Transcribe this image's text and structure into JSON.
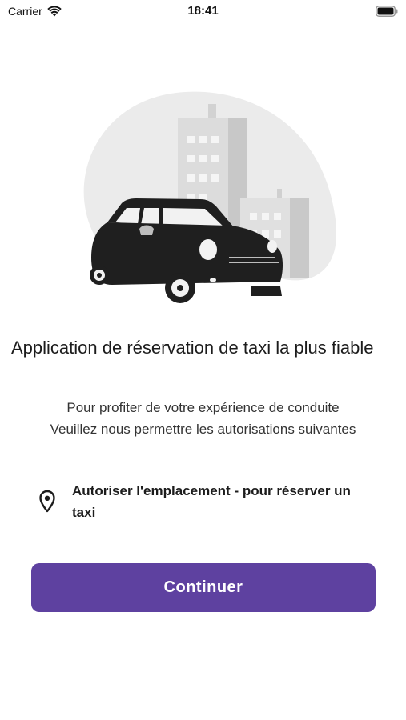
{
  "status_bar": {
    "carrier": "Carrier",
    "time": "18:41",
    "wifi_icon": "wifi-icon",
    "battery_icon": "battery-icon"
  },
  "illustration": {
    "description_icon": "taxi-car-city-illustration",
    "colors": {
      "blob": "#ebebeb",
      "building_light": "#d9d9d9",
      "building_dark": "#c4c4c4",
      "car_body": "#1f1f1f"
    }
  },
  "headline": "Application de réservation de taxi la plus fiable",
  "subtitle": {
    "line1": "Pour profiter de votre expérience de conduite",
    "line2": "Veuillez nous permettre les autorisations suivantes"
  },
  "permissions": [
    {
      "icon": "location-pin-icon",
      "label": "Autoriser l'emplacement - pour réserver un taxi"
    }
  ],
  "continue_button": {
    "label": "Continuer",
    "color": "#5e41a0"
  }
}
